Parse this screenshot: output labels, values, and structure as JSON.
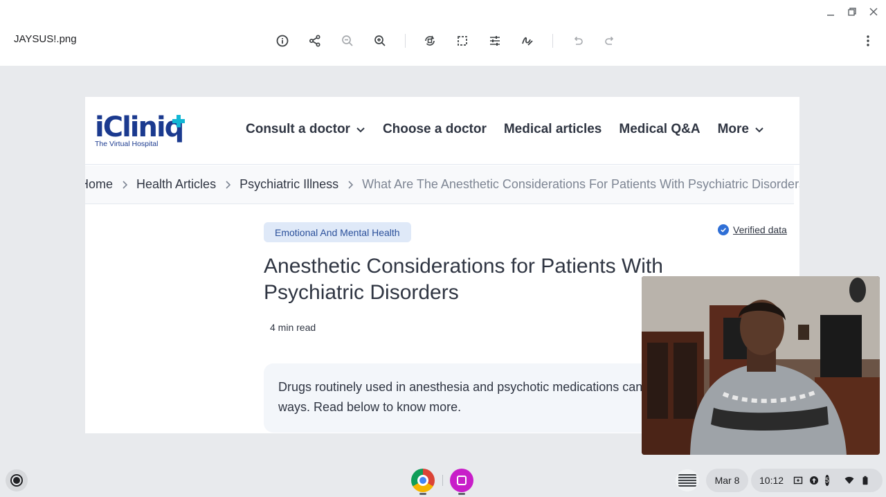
{
  "viewer": {
    "file_name": "JAYSUS!.png"
  },
  "site": {
    "logo_text": "iCliniq",
    "logo_tagline": "The Virtual Hospital",
    "nav": [
      "Consult a doctor",
      "Choose a doctor",
      "Medical articles",
      "Medical Q&A",
      "More"
    ],
    "breadcrumbs": [
      "Home",
      "Health Articles",
      "Psychiatric Illness",
      "What Are The Anesthetic Considerations For Patients With Psychiatric Disorders?"
    ],
    "category_tag": "Emotional And Mental Health",
    "verified_label": "Verified data",
    "article_title": "Anesthetic Considerations for Patients With Psychiatric Disorders",
    "read_time": "4 min read",
    "summary": "Drugs routinely used in anesthesia and psychotic medications can interact in potentially fatal ways. Read below to know more."
  },
  "shelf": {
    "date": "Mar 8",
    "time": "10:12",
    "notification_count": "5"
  },
  "colors": {
    "brand_blue": "#1b3a8f",
    "brand_cyan": "#12b6d4",
    "tag_bg": "#dfe9f8",
    "verified_blue": "#2f6fd6"
  }
}
